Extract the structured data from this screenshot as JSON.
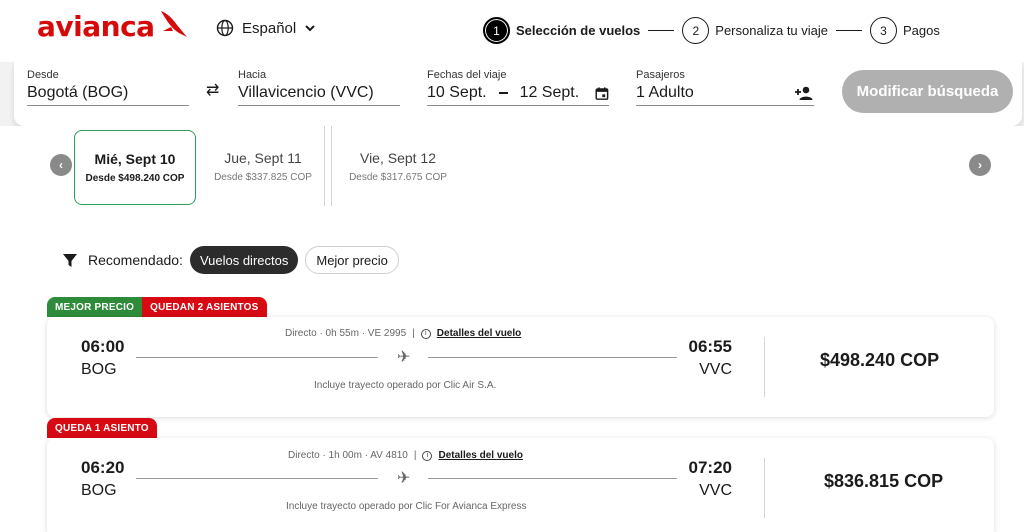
{
  "header": {
    "brand": "avianca",
    "language": "Español",
    "steps": [
      {
        "number": "1",
        "label": "Selección de vuelos"
      },
      {
        "number": "2",
        "label": "Personaliza tu viaje"
      },
      {
        "number": "3",
        "label": "Pagos"
      }
    ]
  },
  "search": {
    "from_label": "Desde",
    "from_value": "Bogotá (BOG)",
    "to_label": "Hacia",
    "to_value": "Villavicencio (VVC)",
    "dates_label": "Fechas del viaje",
    "date_start": "10 Sept.",
    "date_end": "12 Sept.",
    "pax_label": "Pasajeros",
    "pax_value": "1 Adulto",
    "modify_button": "Modificar búsqueda"
  },
  "dates": [
    {
      "day": "Mié, Sept 10",
      "price": "Desde $498.240 COP",
      "selected": true
    },
    {
      "day": "Jue, Sept 11",
      "price": "Desde $337.825 COP",
      "selected": false
    },
    {
      "day": "Vie, Sept 12",
      "price": "Desde $317.675 COP",
      "selected": false
    }
  ],
  "filters": {
    "label": "Recomendado:",
    "chips": [
      "Vuelos directos",
      "Mejor precio"
    ]
  },
  "flights": [
    {
      "badges": [
        "MEJOR PRECIO",
        "QUEDAN 2 ASIENTOS"
      ],
      "departure_time": "06:00",
      "departure_code": "BOG",
      "arrival_time": "06:55",
      "arrival_code": "VVC",
      "info": "Directo · 0h 55m · VE 2995",
      "details_link": "Detalles del vuelo",
      "note": "Incluye trayecto operado por Clic Air S.A.",
      "price": "$498.240 COP"
    },
    {
      "badges": [
        "QUEDA 1 ASIENTO"
      ],
      "departure_time": "06:20",
      "departure_code": "BOG",
      "arrival_time": "07:20",
      "arrival_code": "VVC",
      "info": "Directo · 1h 00m · AV 4810",
      "details_link": "Detalles del vuelo",
      "note": "Incluye trayecto operado por Clic For Avianca Express",
      "price": "$836.815 COP"
    }
  ],
  "colors": {
    "brand_red": "#d70a0a",
    "badge_green": "#2e8b3a",
    "badge_red": "#d70a14",
    "selected_border": "#2e9e5b",
    "button_disabled": "#b0b0b0"
  }
}
